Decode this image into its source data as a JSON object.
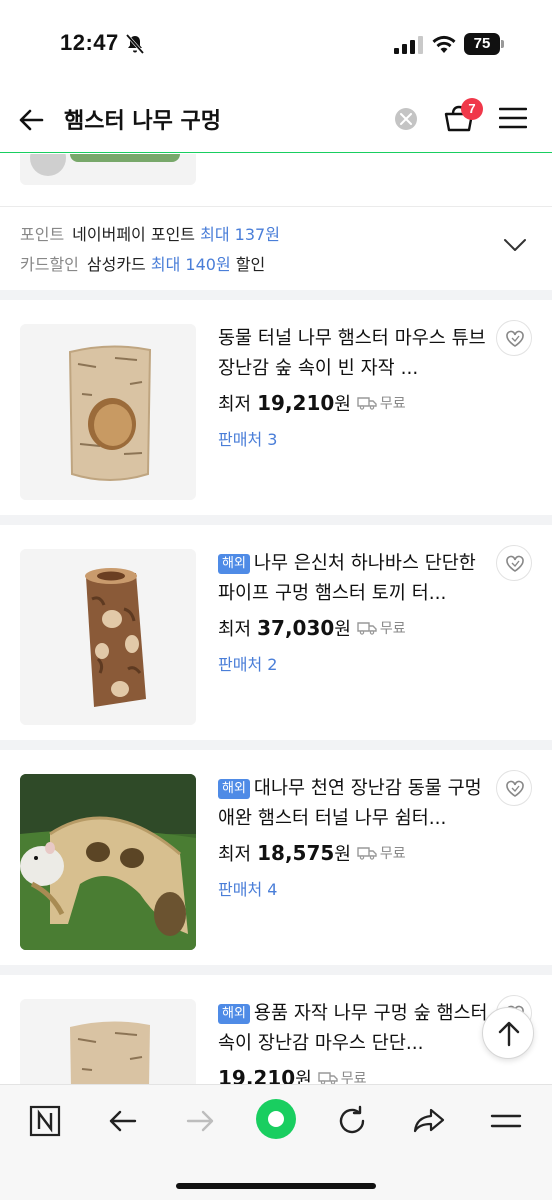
{
  "status_bar": {
    "time": "12:47",
    "battery": "75"
  },
  "search": {
    "query": "햄스터 나무 구멍",
    "cart_count": "7"
  },
  "benefits": {
    "point_label": "포인트",
    "point_text": "네이버페이 포인트",
    "point_max": "최대 137원",
    "card_label": "카드할인",
    "card_text": "삼성카드",
    "card_max": "최대 140원",
    "card_suffix": "할인"
  },
  "products": [
    {
      "tag": "",
      "title": "동물 터널 나무 햄스터 마우스 튜브 장난감 숲 속이 빈 자작 ...",
      "prefix": "최저",
      "price": "19,210",
      "unit": "원",
      "shipping": "무료",
      "sellers": "판매처 3"
    },
    {
      "tag": "해외",
      "title": "나무 은신처 하나바스 단단한 파이프 구멍 햄스터 토끼 터...",
      "prefix": "최저",
      "price": "37,030",
      "unit": "원",
      "shipping": "무료",
      "sellers": "판매처 2"
    },
    {
      "tag": "해외",
      "title": "대나무 천연 장난감 동물 구멍 애완 햄스터 터널 나무 쉼터...",
      "prefix": "최저",
      "price": "18,575",
      "unit": "원",
      "shipping": "무료",
      "sellers": "판매처 4"
    },
    {
      "tag": "해외",
      "title": "용품 자작 나무 구멍 숲 햄스터 속이 장난감 마우스 단단...",
      "prefix": "",
      "price": "19,210",
      "unit": "원",
      "shipping": "무료",
      "sellers": ""
    }
  ],
  "icons": {
    "back": "arrow-left-icon",
    "clear": "clear-x-icon",
    "cart": "cart-icon",
    "menu": "hamburger-icon",
    "wishlist": "heart-icon",
    "shipping": "truck-icon",
    "scroll_top": "arrow-up-icon",
    "toolbar": [
      "naver-n-icon",
      "browser-back-icon",
      "browser-forward-icon",
      "green-dot-icon",
      "refresh-icon",
      "share-icon",
      "menu-icon"
    ]
  },
  "colors": {
    "accent_green": "#19ce60",
    "link_blue": "#4a7ed8",
    "tag_blue": "#4f8be6",
    "badge_red": "#f0384a"
  }
}
